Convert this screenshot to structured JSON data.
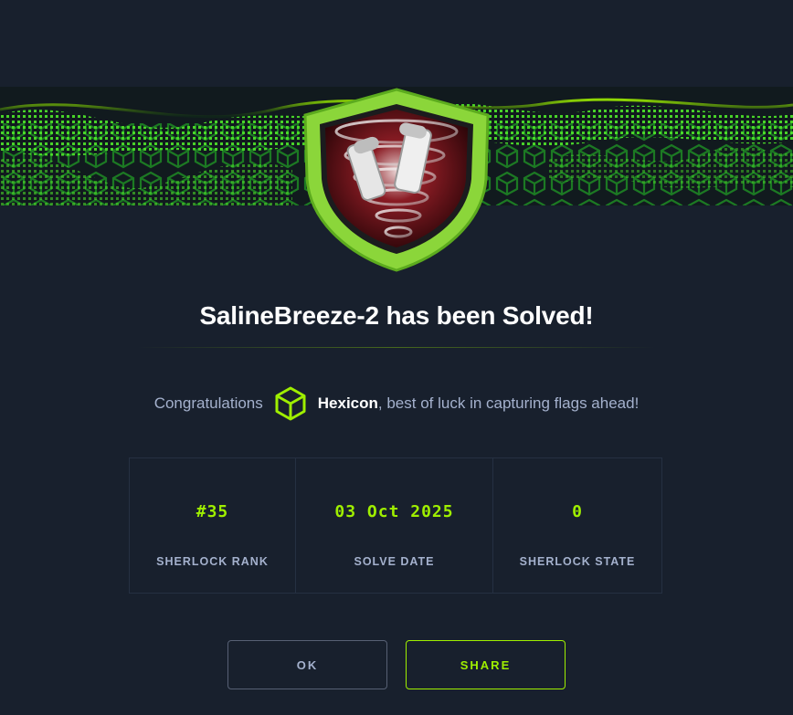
{
  "header": {
    "title": "SalineBreeze-2 has been Solved!"
  },
  "congrats": {
    "prefix": "Congratulations",
    "username": "Hexicon",
    "suffix": ", best of luck in capturing flags ahead!"
  },
  "stats": [
    {
      "value": "#35",
      "label": "SHERLOCK RANK"
    },
    {
      "value": "03 Oct 2025",
      "label": "SOLVE DATE"
    },
    {
      "value": "0",
      "label": "SHERLOCK STATE"
    }
  ],
  "buttons": {
    "ok": "OK",
    "share": "SHARE"
  },
  "colors": {
    "background": "#18202d",
    "accent": "#9fef00",
    "muted_text": "#a4b1cd",
    "badge_red": "#5a0b12"
  },
  "icons": {
    "badge": "tornado-shield-badge",
    "avatar": "cube-icon"
  }
}
